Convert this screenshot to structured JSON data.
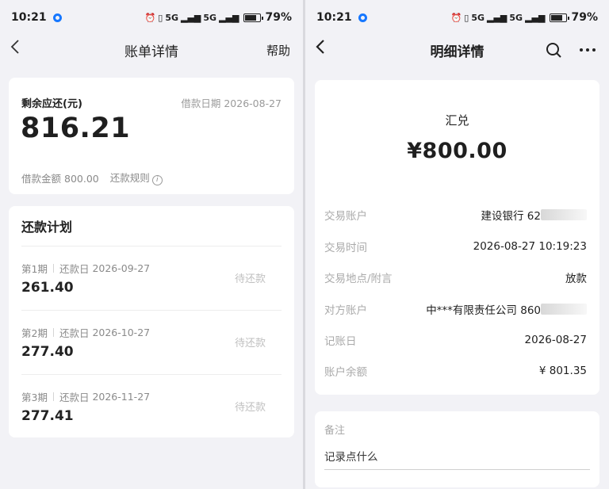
{
  "status_bar": {
    "time": "10:21",
    "battery": "79%",
    "network": "5G"
  },
  "left": {
    "nav": {
      "title": "账单详情",
      "help": "帮助"
    },
    "summary": {
      "label": "剩余应还(元)",
      "loan_date_label": "借款日期",
      "loan_date": "2026-08-27",
      "amount": "816.21",
      "loan_amount_label": "借款金额",
      "loan_amount": "800.00",
      "rules_label": "还款规则"
    },
    "plan": {
      "title": "还款计划",
      "items": [
        {
          "period": "第1期",
          "due_label": "还款日",
          "due_date": "2026-09-27",
          "amount": "261.40",
          "status": "待还款"
        },
        {
          "period": "第2期",
          "due_label": "还款日",
          "due_date": "2026-10-27",
          "amount": "277.40",
          "status": "待还款"
        },
        {
          "period": "第3期",
          "due_label": "还款日",
          "due_date": "2026-11-27",
          "amount": "277.41",
          "status": "待还款"
        }
      ]
    }
  },
  "right": {
    "nav": {
      "title": "明细详情"
    },
    "detail": {
      "type": "汇兑",
      "amount": "¥800.00",
      "rows": [
        {
          "label": "交易账户",
          "value": "建设银行 62"
        },
        {
          "label": "交易时间",
          "value": "2026-08-27 10:19:23"
        },
        {
          "label": "交易地点/附言",
          "value": "放款"
        },
        {
          "label": "对方账户",
          "value": "中***有限责任公司 860"
        },
        {
          "label": "记账日",
          "value": "2026-08-27"
        },
        {
          "label": "账户余额",
          "value": "¥ 801.35"
        }
      ]
    },
    "note": {
      "label": "备注",
      "placeholder": "记录点什么"
    }
  },
  "colors": {
    "page_bg": "#f2f2f6",
    "card_bg": "#ffffff",
    "muted": "#aaaaaa",
    "pending": "#c0c0c0",
    "accent_dot": "#1677ff"
  }
}
